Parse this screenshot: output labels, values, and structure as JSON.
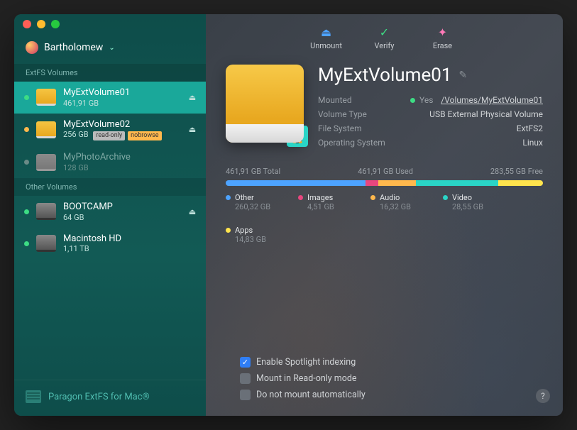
{
  "user": {
    "name": "Bartholomew"
  },
  "sidebar": {
    "section_ext": "ExtFS Volumes",
    "section_other": "Other Volumes",
    "ext": [
      {
        "name": "MyExtVolume01",
        "size": "461,91 GB",
        "status": "green",
        "eject": true,
        "selected": true
      },
      {
        "name": "MyExtVolume02",
        "size": "256 GB",
        "status": "orange",
        "eject": true,
        "badges": [
          "read-only",
          "nobrowse"
        ]
      },
      {
        "name": "MyPhotoArchive",
        "size": "128 GB",
        "status": "gray",
        "dim": true
      }
    ],
    "other": [
      {
        "name": "BOOTCAMP",
        "size": "64 GB",
        "status": "green",
        "eject": true,
        "hd": true
      },
      {
        "name": "Macintosh HD",
        "size": "1,11 TB",
        "status": "green",
        "hd": true
      }
    ],
    "footer": "Paragon ExtFS for Mac®"
  },
  "toolbar": {
    "unmount": "Unmount",
    "verify": "Verify",
    "erase": "Erase"
  },
  "colors": {
    "unmount": "#4da3ff",
    "verify": "#3ddc84",
    "erase": "#ff7ab8",
    "other": "#4da3ff",
    "images": "#e8467e",
    "audio": "#ffb84d",
    "video": "#2ad4c6",
    "apps": "#ffe44d"
  },
  "volume": {
    "title": "MyExtVolume01",
    "meta": {
      "mounted_label": "Mounted",
      "mounted_value": "Yes",
      "path": "/Volumes/MyExtVolume01",
      "type_label": "Volume Type",
      "type_value": "USB External Physical Volume",
      "fs_label": "File System",
      "fs_value": "ExtFS2",
      "os_label": "Operating System",
      "os_value": "Linux"
    }
  },
  "usage": {
    "total": "461,91 GB Total",
    "used": "461,91 GB Used",
    "free": "283,55 GB Free",
    "segments": [
      {
        "key": "other",
        "pct": 44
      },
      {
        "key": "images",
        "pct": 4
      },
      {
        "key": "audio",
        "pct": 12
      },
      {
        "key": "video",
        "pct": 26
      },
      {
        "key": "apps",
        "pct": 14
      }
    ],
    "legend": [
      {
        "key": "other",
        "label": "Other",
        "size": "260,32 GB"
      },
      {
        "key": "images",
        "label": "Images",
        "size": "4,51 GB"
      },
      {
        "key": "audio",
        "label": "Audio",
        "size": "16,32 GB"
      },
      {
        "key": "video",
        "label": "Video",
        "size": "28,55 GB"
      },
      {
        "key": "apps",
        "label": "Apps",
        "size": "14,83 GB"
      }
    ]
  },
  "options": {
    "spotlight": "Enable Spotlight indexing",
    "readonly": "Mount in Read-only mode",
    "noauto": "Do not mount automatically"
  }
}
